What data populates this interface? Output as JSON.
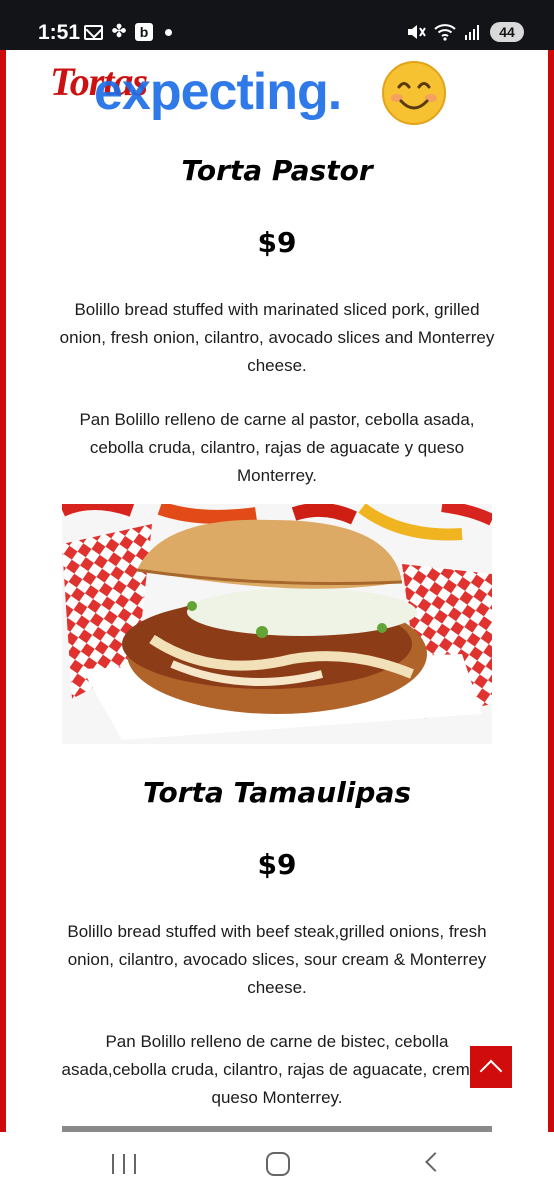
{
  "status_bar": {
    "time": "1:51",
    "b_badge": "b",
    "battery": "44"
  },
  "header": {
    "brand": "Tortas",
    "overlay_text": "expecting."
  },
  "items": [
    {
      "title": "Torta Pastor",
      "price": "$9",
      "desc_en": "Bolillo bread stuffed with marinated sliced pork, grilled onion, fresh onion, cilantro, avocado slices and Monterrey cheese.",
      "desc_es": "Pan Bolillo relleno de carne al pastor, cebolla asada, cebolla cruda, cilantro, rajas de aguacate y queso Monterrey."
    },
    {
      "title": "Torta Tamaulipas",
      "price": "$9",
      "desc_en": "Bolillo bread stuffed with beef steak,grilled onions, fresh onion, cilantro, avocado slices, sour cream & Monterrey cheese.",
      "desc_es": "Pan Bolillo relleno de carne de bistec, cebolla asada,cebolla cruda, cilantro, rajas de aguacate, crema y queso Monterrey."
    }
  ],
  "colors": {
    "brand_red": "#cc0a0a",
    "overlay_blue": "#1e6ee8",
    "status_bg": "#121417"
  },
  "icons": {
    "scroll_top": "chevron-up-icon",
    "nav_recents": "recents-icon",
    "nav_home": "home-icon",
    "nav_back": "back-icon"
  }
}
